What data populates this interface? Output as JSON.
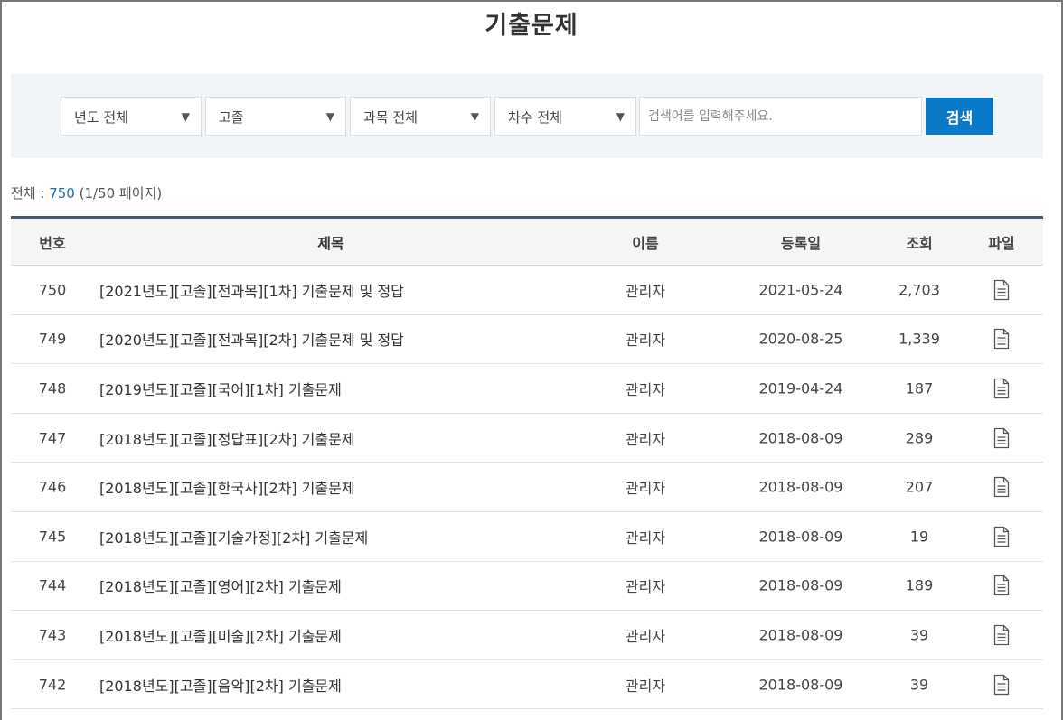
{
  "page": {
    "title": "기출문제"
  },
  "filters": {
    "year": {
      "selected": "년도 전체"
    },
    "school": {
      "selected": "고졸"
    },
    "subject": {
      "selected": "과목 전체"
    },
    "round": {
      "selected": "차수 전체"
    },
    "search": {
      "placeholder": "검색어를 입력해주세요.",
      "value": ""
    },
    "search_button_label": "검색",
    "dropdown_arrow": "▼"
  },
  "summary": {
    "total_label": "전체 : ",
    "total_count": "750",
    "page_info": " (1/50 페이지)"
  },
  "table": {
    "headers": {
      "no": "번호",
      "title": "제목",
      "name": "이름",
      "date": "등록일",
      "views": "조회",
      "file": "파일"
    },
    "rows": [
      {
        "no": "750",
        "title": "[2021년도][고졸][전과목][1차] 기출문제 및 정답",
        "name": "관리자",
        "date": "2021-05-24",
        "views": "2,703",
        "file_icon": "document-icon"
      },
      {
        "no": "749",
        "title": "[2020년도][고졸][전과목][2차] 기출문제 및 정답",
        "name": "관리자",
        "date": "2020-08-25",
        "views": "1,339",
        "file_icon": "document-icon"
      },
      {
        "no": "748",
        "title": "[2019년도][고졸][국어][1차] 기출문제",
        "name": "관리자",
        "date": "2019-04-24",
        "views": "187",
        "file_icon": "document-icon"
      },
      {
        "no": "747",
        "title": "[2018년도][고졸][정답표][2차] 기출문제",
        "name": "관리자",
        "date": "2018-08-09",
        "views": "289",
        "file_icon": "document-icon"
      },
      {
        "no": "746",
        "title": "[2018년도][고졸][한국사][2차] 기출문제",
        "name": "관리자",
        "date": "2018-08-09",
        "views": "207",
        "file_icon": "document-icon"
      },
      {
        "no": "745",
        "title": "[2018년도][고졸][기술가정][2차] 기출문제",
        "name": "관리자",
        "date": "2018-08-09",
        "views": "19",
        "file_icon": "document-icon"
      },
      {
        "no": "744",
        "title": "[2018년도][고졸][영어][2차] 기출문제",
        "name": "관리자",
        "date": "2018-08-09",
        "views": "189",
        "file_icon": "document-icon"
      },
      {
        "no": "743",
        "title": "[2018년도][고졸][미술][2차] 기출문제",
        "name": "관리자",
        "date": "2018-08-09",
        "views": "39",
        "file_icon": "document-icon"
      },
      {
        "no": "742",
        "title": "[2018년도][고졸][음악][2차] 기출문제",
        "name": "관리자",
        "date": "2018-08-09",
        "views": "39",
        "file_icon": "document-icon"
      }
    ]
  },
  "colors": {
    "accent": "#0a79c7",
    "count_link": "#1a6fb0",
    "table_top_border": "#3e5a78",
    "search_panel_bg": "#f2f5f8"
  }
}
